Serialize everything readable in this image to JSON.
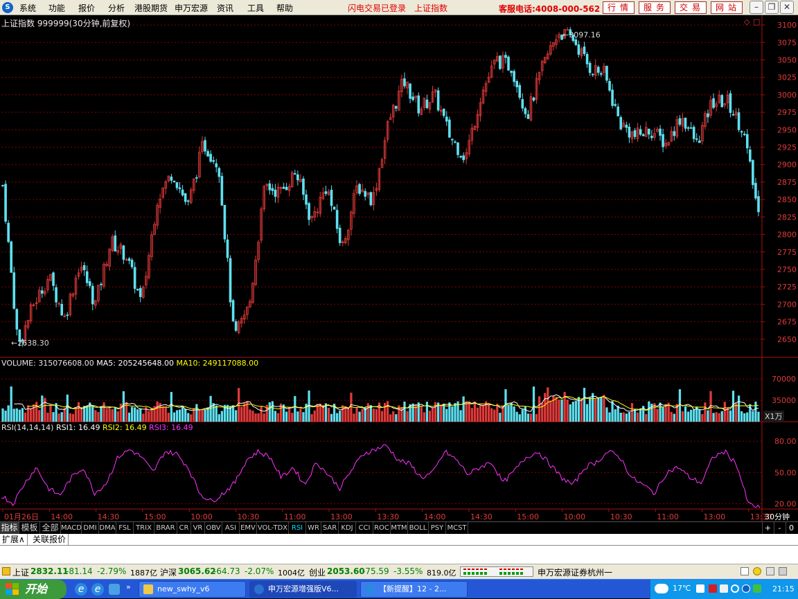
{
  "app": {
    "logo_glyph": "S",
    "menu": [
      "系统",
      "功能",
      "报价",
      "分析",
      "港股期货",
      "申万宏源",
      "资讯",
      "工具",
      "帮助"
    ],
    "notices": [
      "闪电交易已登录",
      "上证指数"
    ],
    "hotline": "客服电话:4008-000-562",
    "top_buttons": [
      "行情",
      "服务",
      "交易",
      "网站"
    ],
    "window_buttons": [
      "minimize",
      "restore",
      "close"
    ]
  },
  "chart": {
    "header": "上证指数 999999(30分钟,前复权)",
    "corner_icons": [
      "◇",
      "□"
    ],
    "high_label": "3097.16",
    "low_label": "2638.30",
    "volume_header": {
      "label": "VOLUME: 315076608.00",
      "ma5": "MA5: 205245648.00",
      "ma10": "MA10: 249117088.00"
    },
    "rsi_header": {
      "label": "RSI(14,14,14)",
      "rsi1": "RSI1: 16.49",
      "rsi2": "RSI2: 16.49",
      "rsi3": "RSI3: 16.49"
    },
    "unit_label": "X1万",
    "period_label": "30分钟",
    "colors": {
      "up": "#e23a3a",
      "down": "#5ee0f0",
      "grid": "#8b0000",
      "axis": "#b01010",
      "ma5": "#ffffff",
      "ma10": "#ffff00",
      "rsi": "#ff33ff"
    }
  },
  "chart_data": [
    {
      "type": "candlestick",
      "title": "上证指数 999999(30分钟,前复权)",
      "y_ticks": [
        3100,
        3075,
        3050,
        3025,
        3000,
        2975,
        2950,
        2925,
        2900,
        2875,
        2850,
        2825,
        2800,
        2775,
        2750,
        2725,
        2700,
        2675,
        2650
      ],
      "ylim": [
        2630,
        3108
      ],
      "high": 3097.16,
      "low": 2638.3,
      "x_ticks": [
        "01月26日",
        "14:00",
        "14:30",
        "15:00",
        "10:00",
        "10:30",
        "11:00",
        "13:00",
        "13:30",
        "14:00",
        "14:30",
        "15:00",
        "10:00",
        "10:30",
        "11:00",
        "13:00",
        "13:30"
      ],
      "close_path": [
        2870,
        2640,
        2700,
        2740,
        2680,
        2760,
        2700,
        2790,
        2770,
        2700,
        2850,
        2890,
        2840,
        2930,
        2900,
        2650,
        2700,
        2870,
        2860,
        2890,
        2820,
        2870,
        2780,
        2870,
        2850,
        2960,
        3020,
        2980,
        3000,
        2940,
        2910,
        3000,
        3050,
        3040,
        2970,
        3040,
        3090,
        3080,
        3040,
        3030,
        2960,
        2940,
        2950,
        2930,
        2970,
        2930,
        2990,
        2990,
        2950,
        2830
      ]
    },
    {
      "type": "bar",
      "title": "VOLUME",
      "y_ticks": [
        70000,
        35000
      ],
      "ylim": [
        0,
        85000
      ],
      "series": [
        {
          "name": "MA5",
          "color": "#ffffff"
        },
        {
          "name": "MA10",
          "color": "#ffff00"
        }
      ]
    },
    {
      "type": "line",
      "title": "RSI(14,14,14)",
      "y_ticks": [
        80.0,
        50.0,
        20.0
      ],
      "ylim": [
        15,
        90
      ],
      "series_path": [
        28,
        20,
        40,
        55,
        35,
        28,
        45,
        55,
        30,
        40,
        65,
        72,
        65,
        50,
        70,
        68,
        55,
        30,
        22,
        30,
        40,
        62,
        70,
        65,
        45,
        55,
        38,
        60,
        48,
        35,
        52,
        68,
        72,
        76,
        62,
        58,
        45,
        50,
        70,
        62,
        48,
        55,
        60,
        40,
        52,
        65,
        70,
        58,
        45,
        38,
        55,
        60,
        70,
        65,
        45,
        38,
        30,
        50,
        55,
        45,
        40,
        65,
        70,
        58,
        20,
        16
      ]
    }
  ],
  "indicator_tabs": [
    "指标",
    "模板",
    "全部",
    "MACD",
    "DMI",
    "DMA",
    "FSL",
    "TRIX",
    "BRAR",
    "CR",
    "VR",
    "OBV",
    "ASI",
    "EMV",
    "VOL-TDX",
    "RSI",
    "WR",
    "SAR",
    "KDJ",
    "CCI",
    "ROC",
    "MTM",
    "BOLL",
    "PSY",
    "MCST"
  ],
  "right_controls": [
    "+",
    "-",
    "0"
  ],
  "ext_tabs": [
    "扩展∧",
    "关联报价"
  ],
  "status": {
    "indices": [
      {
        "name": "上证",
        "value": "2832.11",
        "chg": "-81.14",
        "pct": "-2.79%",
        "amt": "1887亿"
      },
      {
        "name": "沪深",
        "value": "3065.62",
        "chg": "-64.73",
        "pct": "-2.07%",
        "amt": "1004亿"
      },
      {
        "name": "创业",
        "value": "2053.60",
        "chg": "-75.59",
        "pct": "-3.55%",
        "amt": "819.0亿"
      }
    ],
    "broker": "申万宏源证券杭州一"
  },
  "taskbar": {
    "start": "开始",
    "tasks": [
      "new_swhy_v6",
      "申万宏源增强版V6...",
      "【新提醒】12 - 2..."
    ],
    "weather": "17℃",
    "clock": "21:15"
  }
}
